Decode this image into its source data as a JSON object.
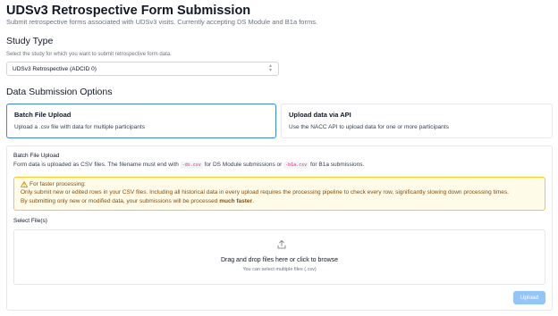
{
  "header": {
    "title": "UDSv3 Retrospective Form Submission",
    "subtitle": "Submit retrospective forms associated with UDSv3 visits. Currently accepting DS Module and B1a forms."
  },
  "study_type": {
    "title": "Study Type",
    "hint": "Select the study for which you want to submit retrospective form data.",
    "selected_value": "UDSv3 Retrospective (ADCID 0)"
  },
  "submission_options": {
    "title": "Data Submission Options",
    "options": [
      {
        "title": "Batch File Upload",
        "description": "Upload a .csv file with data for multiple participants",
        "active": true
      },
      {
        "title": "Upload data via API",
        "description": "Use the NACC API to upload data for one or more participants",
        "active": false
      }
    ]
  },
  "batch_panel": {
    "title": "Batch File Upload",
    "desc_prefix": "Form data is uploaded as CSV files. The filename must end with",
    "code_ds": "-ds.csv",
    "desc_middle": "for DS Module submissions or",
    "code_b1a": "-b1a.csv",
    "desc_suffix": "for B1a submissions.",
    "alert": {
      "title": "For faster processing:",
      "body_line1": "Only submit new or edited rows in your CSV files. Including all historical data in every upload requires the processing pipeline to check every row, significantly slowing down processing times.",
      "body_line2_prefix": "By submitting only new or modified data, your submissions will be processed",
      "body_line2_bold": "much faster",
      "body_line2_suffix": "."
    },
    "files_label": "Select File(s)",
    "dropzone_main": "Drag and drop files here or click to browse",
    "dropzone_sub": "You can select multiple files (.csv)",
    "upload_label": "Upload"
  },
  "colors": {
    "accent": "#3b82f6",
    "upload_disabled": "#93c5fd",
    "alert_bg": "#fefce8",
    "alert_border": "#facc15",
    "alert_text": "#854d0e",
    "code_text": "#db2777"
  }
}
